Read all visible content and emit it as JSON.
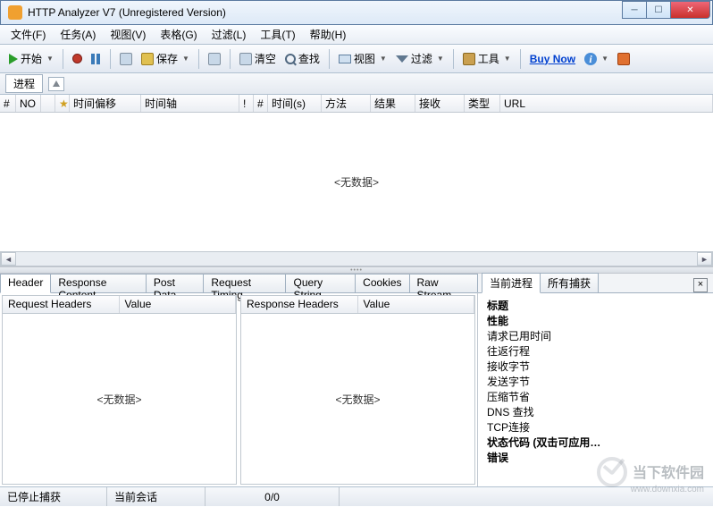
{
  "window": {
    "title": "HTTP Analyzer V7  (Unregistered Version)"
  },
  "menu": {
    "file": "文件(F)",
    "task": "任务(A)",
    "view": "视图(V)",
    "grid": "表格(G)",
    "filter": "过滤(L)",
    "tool": "工具(T)",
    "help": "帮助(H)"
  },
  "toolbar": {
    "start": "开始",
    "save": "保存",
    "clear": "清空",
    "find": "查找",
    "view": "视图",
    "filter": "过滤",
    "tool": "工具",
    "buy": "Buy Now"
  },
  "procbar": {
    "process": "进程"
  },
  "columns": {
    "hash": "#",
    "no": "NO",
    "offset": "时间偏移",
    "timeline": "时间轴",
    "bang": "!",
    "num": "#",
    "time_s": "时间(s)",
    "method": "方法",
    "result": "结果",
    "recv": "接收",
    "type": "类型",
    "url": "URL"
  },
  "grid": {
    "empty": "<无数据>"
  },
  "detail_tabs": {
    "header": "Header",
    "response": "Response Content",
    "post": "Post Data",
    "timing": "Request Timing",
    "query": "Query String",
    "cookies": "Cookies",
    "raw": "Raw Stream"
  },
  "panes": {
    "req_hdr": "Request Headers",
    "resp_hdr": "Response Headers",
    "value": "Value",
    "empty": "<无数据>"
  },
  "right_tabs": {
    "current": "当前进程",
    "all": "所有捕获"
  },
  "props": {
    "title": "标题",
    "perf": "性能",
    "req_time": "请求已用时间",
    "roundtrip": "往返行程",
    "recv_bytes": "接收字节",
    "send_bytes": "发送字节",
    "compress": "压缩节省",
    "dns": "DNS 查找",
    "tcp": "TCP连接",
    "status": "状态代码 (双击可应用…",
    "error": "错误"
  },
  "status": {
    "stopped": "已停止捕获",
    "session": "当前会话",
    "count": "0/0"
  },
  "watermark": {
    "brand": "当下软件园",
    "url": "www.downxia.com"
  }
}
